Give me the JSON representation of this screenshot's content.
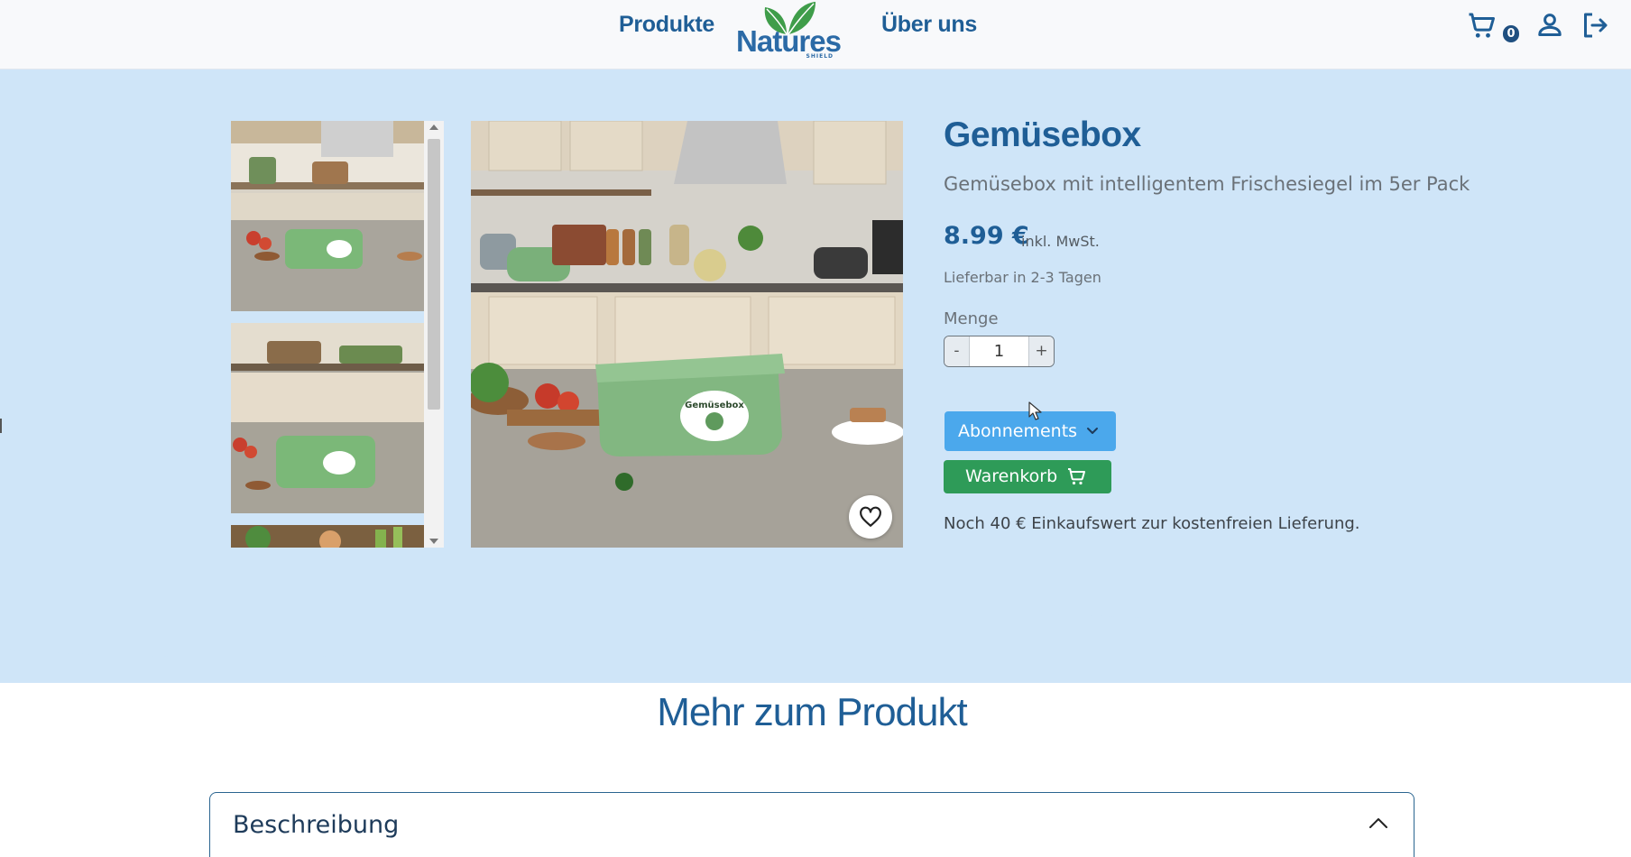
{
  "header": {
    "nav_products": "Produkte",
    "nav_about": "Über uns",
    "logo_text": "Natures",
    "logo_sub": "SHIELD",
    "cart_count": "0",
    "icons": [
      "cart-icon",
      "user-icon",
      "logout-icon"
    ]
  },
  "product": {
    "title": "Gemüsebox",
    "subtitle": "Gemüsebox mit intelligentem Frischesiegel im 5er Pack",
    "price": "8.99 €",
    "vat": "inkl. MwSt.",
    "delivery": "Lieferbar in 2-3 Tagen",
    "quantity_label": "Menge",
    "quantity_value": "1",
    "minus": "-",
    "plus": "+",
    "subscription_label": "Abonnements",
    "cart_button": "Warenkorb",
    "free_shipping_note": "Noch 40 € Einkaufswert zur kostenfreien Lieferung.",
    "image_label": "Gemüsebox"
  },
  "more": {
    "heading": "Mehr zum Produkt",
    "accordion_title": "Beschreibung"
  },
  "colors": {
    "brand_blue": "#1f5e96",
    "hero_bg": "#cfe5f8",
    "subscription": "#4ba8ec",
    "cart_green": "#2e9b58"
  }
}
